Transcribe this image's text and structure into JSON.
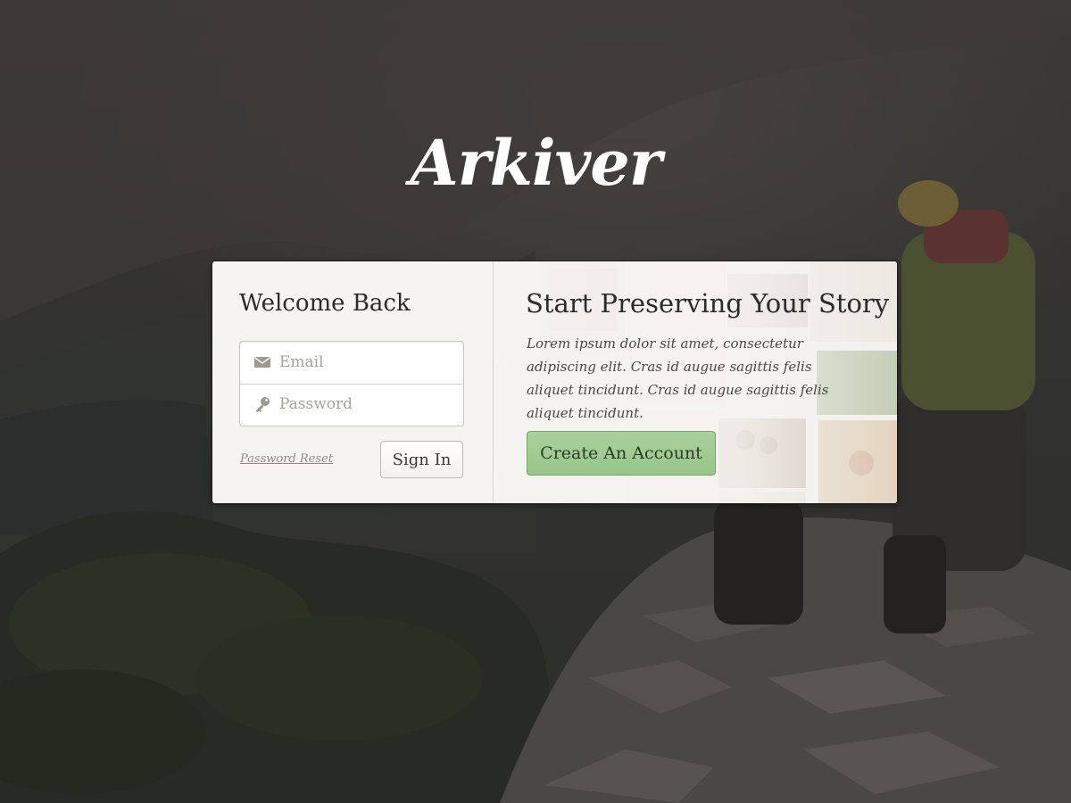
{
  "logo": {
    "text": "Arkiver"
  },
  "signin": {
    "title": "Welcome Back",
    "email_placeholder": "Email",
    "email_value": "",
    "password_placeholder": "Password",
    "password_value": "",
    "reset_link": "Password Reset",
    "submit_label": "Sign In",
    "email_icon": "envelope-icon",
    "password_icon": "key-icon"
  },
  "promo": {
    "title": "Start Preserving Your Story",
    "body": "Lorem ipsum dolor sit amet, consectetur adipiscing elit. Cras id augue sagittis felis aliquet tincidunt. Cras id augue sagittis felis aliquet tincidunt.",
    "cta_label": "Create An Account",
    "cta_color": "#9fcb8f"
  },
  "colors": {
    "card_background": "#f6f4f1",
    "text_dark": "#2c2c2c",
    "muted": "#8f8a83"
  }
}
